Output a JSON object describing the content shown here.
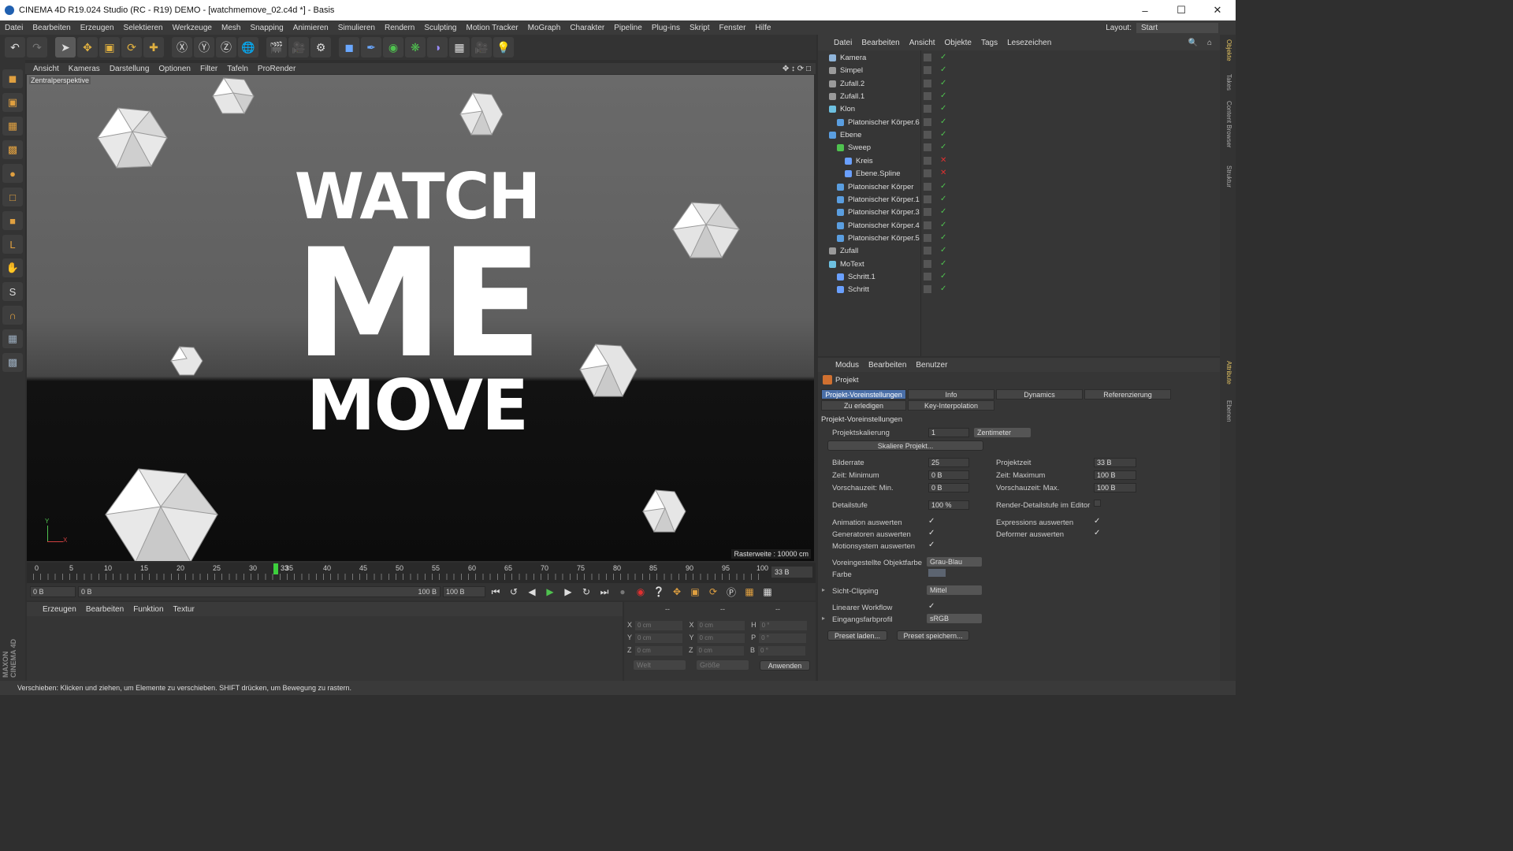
{
  "window": {
    "title": "CINEMA 4D R19.024 Studio (RC - R19) DEMO - [watchmemove_02.c4d *] - Basis"
  },
  "menubar": [
    "Datei",
    "Bearbeiten",
    "Erzeugen",
    "Selektieren",
    "Werkzeuge",
    "Mesh",
    "Snapping",
    "Animieren",
    "Simulieren",
    "Rendern",
    "Sculpting",
    "Motion Tracker",
    "MoGraph",
    "Charakter",
    "Pipeline",
    "Plug-ins",
    "Skript",
    "Fenster",
    "Hilfe"
  ],
  "layout": {
    "label": "Layout:",
    "value": "Start"
  },
  "viewport": {
    "menu": [
      "Ansicht",
      "Kameras",
      "Darstellung",
      "Optionen",
      "Filter",
      "Tafeln",
      "ProRender"
    ],
    "label": "Zentralperspektive",
    "raster": "Rasterweite : 10000 cm",
    "text_line1": "WATCH",
    "text_line2": "ME",
    "text_line3": "MOVE",
    "axis_y": "Y",
    "axis_x": "X"
  },
  "timeline": {
    "ticks": [
      "0",
      "5",
      "10",
      "15",
      "20",
      "25",
      "30",
      "35",
      "40",
      "45",
      "50",
      "55",
      "60",
      "65",
      "70",
      "75",
      "80",
      "85",
      "90",
      "95",
      "100"
    ],
    "current": "33",
    "end_field": "33 B"
  },
  "transport": {
    "start": "0 B",
    "range_start": "0 B",
    "range_end": "100 B",
    "end": "100 B"
  },
  "material": {
    "menu": [
      "Erzeugen",
      "Bearbeiten",
      "Funktion",
      "Textur"
    ]
  },
  "coords": {
    "head": [
      "--",
      "--",
      "--"
    ],
    "rows": [
      {
        "a": "X",
        "av": "0 cm",
        "b": "X",
        "bv": "0 cm",
        "c": "H",
        "cv": "0 °"
      },
      {
        "a": "Y",
        "av": "0 cm",
        "b": "Y",
        "bv": "0 cm",
        "c": "P",
        "cv": "0 °"
      },
      {
        "a": "Z",
        "av": "0 cm",
        "b": "Z",
        "bv": "0 cm",
        "c": "B",
        "cv": "0 °"
      }
    ],
    "sel1": "Welt",
    "sel2": "Größe",
    "apply": "Anwenden"
  },
  "status": "Verschieben: Klicken und ziehen, um Elemente zu verschieben. SHIFT drücken, um Bewegung zu rastern.",
  "brand": "MAXON CINEMA 4D",
  "right_tabs": [
    "Objekte",
    "Takes",
    "Content Browser",
    "Struktur",
    "Attribute",
    "Ebenen"
  ],
  "objects": {
    "menu": [
      "Datei",
      "Bearbeiten",
      "Ansicht",
      "Objekte",
      "Tags",
      "Lesezeichen"
    ],
    "items": [
      {
        "name": "Kamera",
        "depth": 0,
        "color": "#8fb4d9"
      },
      {
        "name": "Simpel",
        "depth": 0,
        "color": "#9a9a9a"
      },
      {
        "name": "Zufall.2",
        "depth": 0,
        "color": "#9a9a9a"
      },
      {
        "name": "Zufall.1",
        "depth": 0,
        "color": "#9a9a9a"
      },
      {
        "name": "Klon",
        "depth": 0,
        "color": "#6dc0e0"
      },
      {
        "name": "Platonischer Körper.6",
        "depth": 1,
        "color": "#5a9ee0"
      },
      {
        "name": "Ebene",
        "depth": 0,
        "color": "#5a9ee0"
      },
      {
        "name": "Sweep",
        "depth": 1,
        "color": "#4fc24f"
      },
      {
        "name": "Kreis",
        "depth": 2,
        "color": "#6aa0ff"
      },
      {
        "name": "Ebene.Spline",
        "depth": 2,
        "color": "#6aa0ff"
      },
      {
        "name": "Platonischer Körper",
        "depth": 1,
        "color": "#5a9ee0"
      },
      {
        "name": "Platonischer Körper.1",
        "depth": 1,
        "color": "#5a9ee0"
      },
      {
        "name": "Platonischer Körper.3",
        "depth": 1,
        "color": "#5a9ee0"
      },
      {
        "name": "Platonischer Körper.4",
        "depth": 1,
        "color": "#5a9ee0"
      },
      {
        "name": "Platonischer Körper.5",
        "depth": 1,
        "color": "#5a9ee0"
      },
      {
        "name": "Zufall",
        "depth": 0,
        "color": "#9a9a9a"
      },
      {
        "name": "MoText",
        "depth": 0,
        "color": "#6dc0e0"
      },
      {
        "name": "Schritt.1",
        "depth": 1,
        "color": "#6aa0ff"
      },
      {
        "name": "Schritt",
        "depth": 1,
        "color": "#6aa0ff"
      }
    ]
  },
  "attributes": {
    "menu": [
      "Modus",
      "Bearbeiten",
      "Benutzer"
    ],
    "header": "Projekt",
    "tabs": [
      "Projekt-Voreinstellungen",
      "Info",
      "Dynamics",
      "Referenzierung",
      "Zu erledigen",
      "Key-Interpolation"
    ],
    "section": "Projekt-Voreinstellungen",
    "skalierung_label": "Projektskalierung",
    "skalierung_value": "1",
    "skalierung_unit": "Zentimeter",
    "skaliere_btn": "Skaliere Projekt...",
    "bilderrate_label": "Bilderrate",
    "bilderrate": "25",
    "projektzeit_label": "Projektzeit",
    "projektzeit": "33 B",
    "zeitmin_label": "Zeit: Minimum",
    "zeitmin": "0 B",
    "zeitmax_label": "Zeit: Maximum",
    "zeitmax": "100 B",
    "vmin_label": "Vorschauzeit: Min.",
    "vmin": "0 B",
    "vmax_label": "Vorschauzeit: Max.",
    "vmax": "100 B",
    "detail_label": "Detailstufe",
    "detail": "100 %",
    "renderdetail_label": "Render-Detailstufe im Editor",
    "anim_label": "Animation auswerten",
    "expr_label": "Expressions auswerten",
    "gen_label": "Generatoren auswerten",
    "deform_label": "Deformer auswerten",
    "motion_label": "Motionsystem auswerten",
    "objfarbe_label": "Voreingestellte Objektfarbe",
    "objfarbe": "Grau-Blau",
    "farbe_label": "Farbe",
    "clip_label": "Sicht-Clipping",
    "clip": "Mittel",
    "linear_label": "Linearer Workflow",
    "profil_label": "Eingangsfarbprofil",
    "profil": "sRGB",
    "preset_load": "Preset laden...",
    "preset_save": "Preset speichern..."
  }
}
